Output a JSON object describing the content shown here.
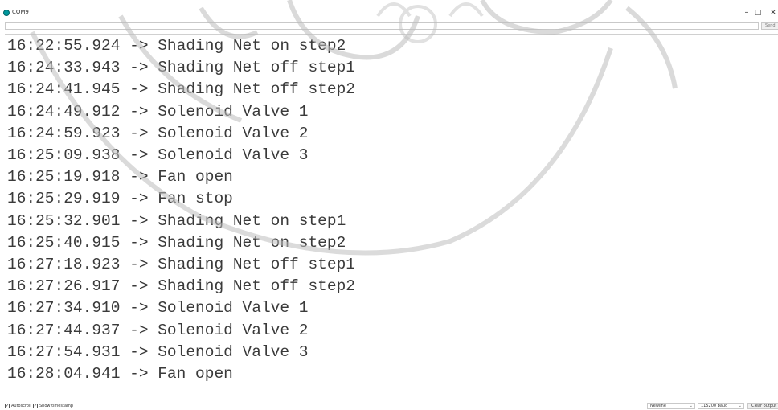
{
  "window": {
    "title": "COM9",
    "minimize_glyph": "–",
    "maximize_glyph": "□",
    "close_glyph": "×"
  },
  "send": {
    "input_value": "",
    "button_label": "Send"
  },
  "log_lines": [
    "16:22:55.924 -> Shading Net on step2",
    "16:24:33.943 -> Shading Net off step1",
    "16:24:41.945 -> Shading Net off step2",
    "16:24:49.912 -> Solenoid Valve 1",
    "16:24:59.923 -> Solenoid Valve 2",
    "16:25:09.938 -> Solenoid Valve 3",
    "16:25:19.918 -> Fan open",
    "16:25:29.919 -> Fan stop",
    "16:25:32.901 -> Shading Net on step1",
    "16:25:40.915 -> Shading Net on step2",
    "16:27:18.923 -> Shading Net off step1",
    "16:27:26.917 -> Shading Net off step2",
    "16:27:34.910 -> Solenoid Valve 1",
    "16:27:44.937 -> Solenoid Valve 2",
    "16:27:54.931 -> Solenoid Valve 3",
    "16:28:04.941 -> Fan open"
  ],
  "status": {
    "autoscroll_label": "Autoscroll",
    "autoscroll_checked": true,
    "timestamp_label": "Show timestamp",
    "timestamp_checked": true,
    "line_ending": "Newline",
    "baud_rate": "115200 baud",
    "clear_label": "Clear output",
    "check_glyph": "✓",
    "dropdown_glyph": "⌄"
  },
  "colors": {
    "app_icon": "#00979c",
    "text": "#3a3a3a",
    "watermark": "#bdbdbd"
  }
}
